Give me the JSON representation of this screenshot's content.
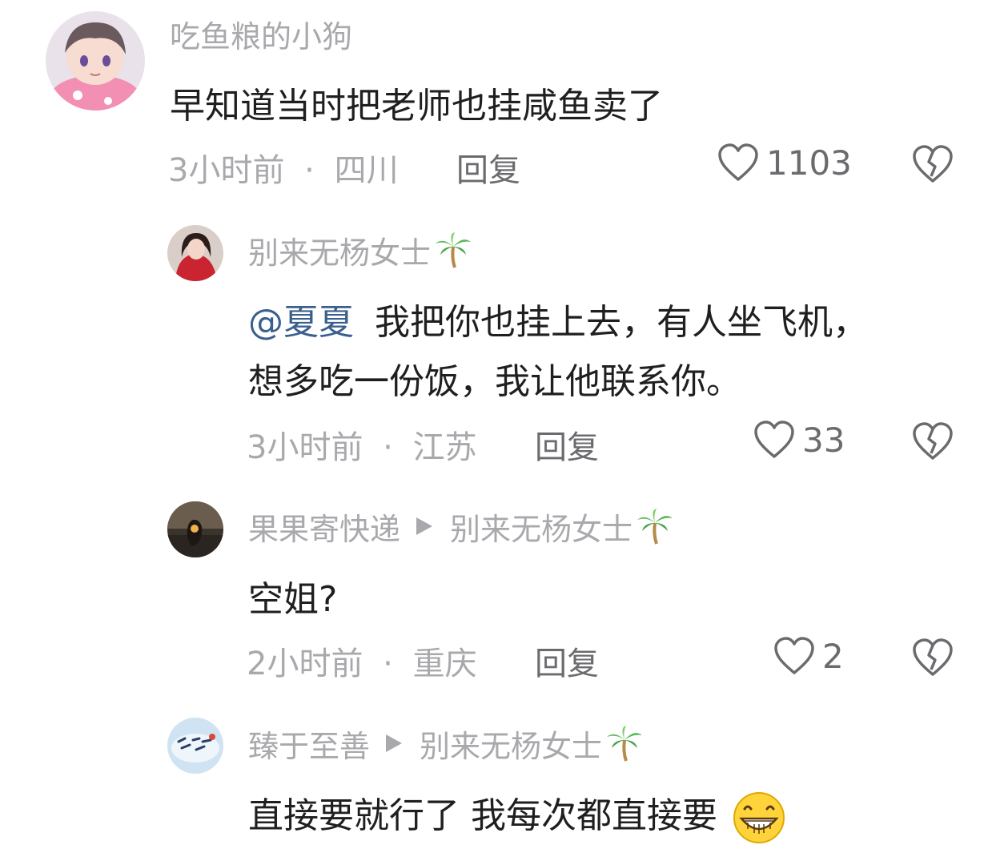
{
  "comments": [
    {
      "user": "吃鱼粮的小狗",
      "text": "早知道当时把老师也挂咸鱼卖了",
      "time": "3小时前",
      "location": "四川",
      "reply_label": "回复",
      "likes": "1103"
    },
    {
      "user": "别来无杨女士",
      "mention": "@夏夏",
      "text_line1": "我把你也挂上去，有人坐飞机，",
      "text_line2": "想多吃一份饭，我让他联系你。",
      "time": "3小时前",
      "location": "江苏",
      "reply_label": "回复",
      "likes": "33"
    },
    {
      "user": "果果寄快递",
      "reply_to": "别来无杨女士",
      "text": "空姐?",
      "time": "2小时前",
      "location": "重庆",
      "reply_label": "回复",
      "likes": "2"
    },
    {
      "user": "臻于至善",
      "reply_to": "别来无杨女士",
      "text": "直接要就行了 我每次都直接要"
    }
  ],
  "separator": "·",
  "icons": {
    "like": "heart-outline-icon",
    "dislike": "broken-heart-icon",
    "name_badge": "palm-tree-emoji",
    "reply_arrow": "triangle-right-icon",
    "grin": "grinning-face-emoji"
  },
  "colors": {
    "name": "#a9a9ad",
    "text": "#1f1f1f",
    "mention": "#3a5f8e",
    "action": "#6b6b6f"
  }
}
